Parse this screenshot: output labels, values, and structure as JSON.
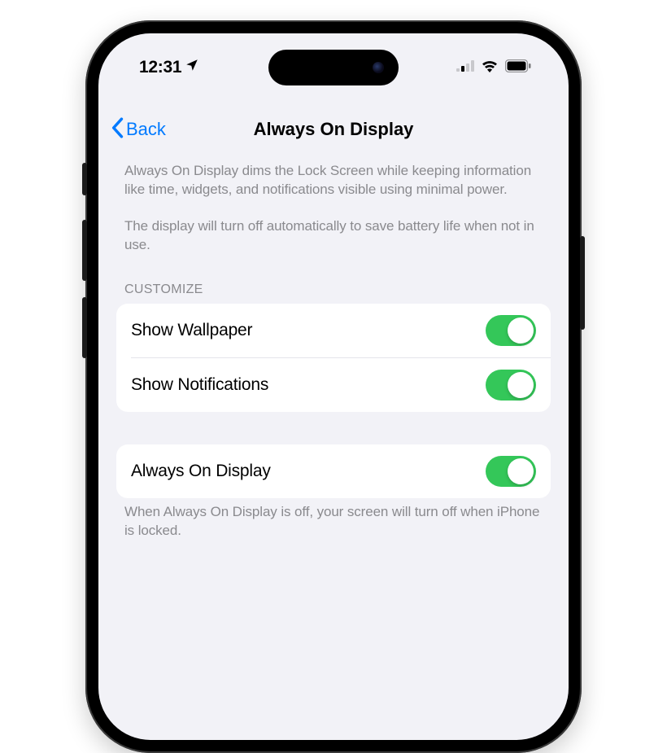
{
  "status": {
    "time": "12:31",
    "location_active": true
  },
  "nav": {
    "back_label": "Back",
    "title": "Always On Display"
  },
  "intro": {
    "p1": "Always On Display dims the Lock Screen while keeping information like time, widgets, and notifications visible using minimal power.",
    "p2": "The display will turn off automatically to save battery life when not in use."
  },
  "customize": {
    "header": "CUSTOMIZE",
    "rows": [
      {
        "label": "Show Wallpaper",
        "on": true
      },
      {
        "label": "Show Notifications",
        "on": true
      }
    ]
  },
  "main": {
    "rows": [
      {
        "label": "Always On Display",
        "on": true
      }
    ],
    "footer": "When Always On Display is off, your screen will turn off when iPhone is locked."
  },
  "colors": {
    "accent": "#007aff",
    "toggle_on": "#34c759",
    "bg": "#f2f2f7"
  }
}
